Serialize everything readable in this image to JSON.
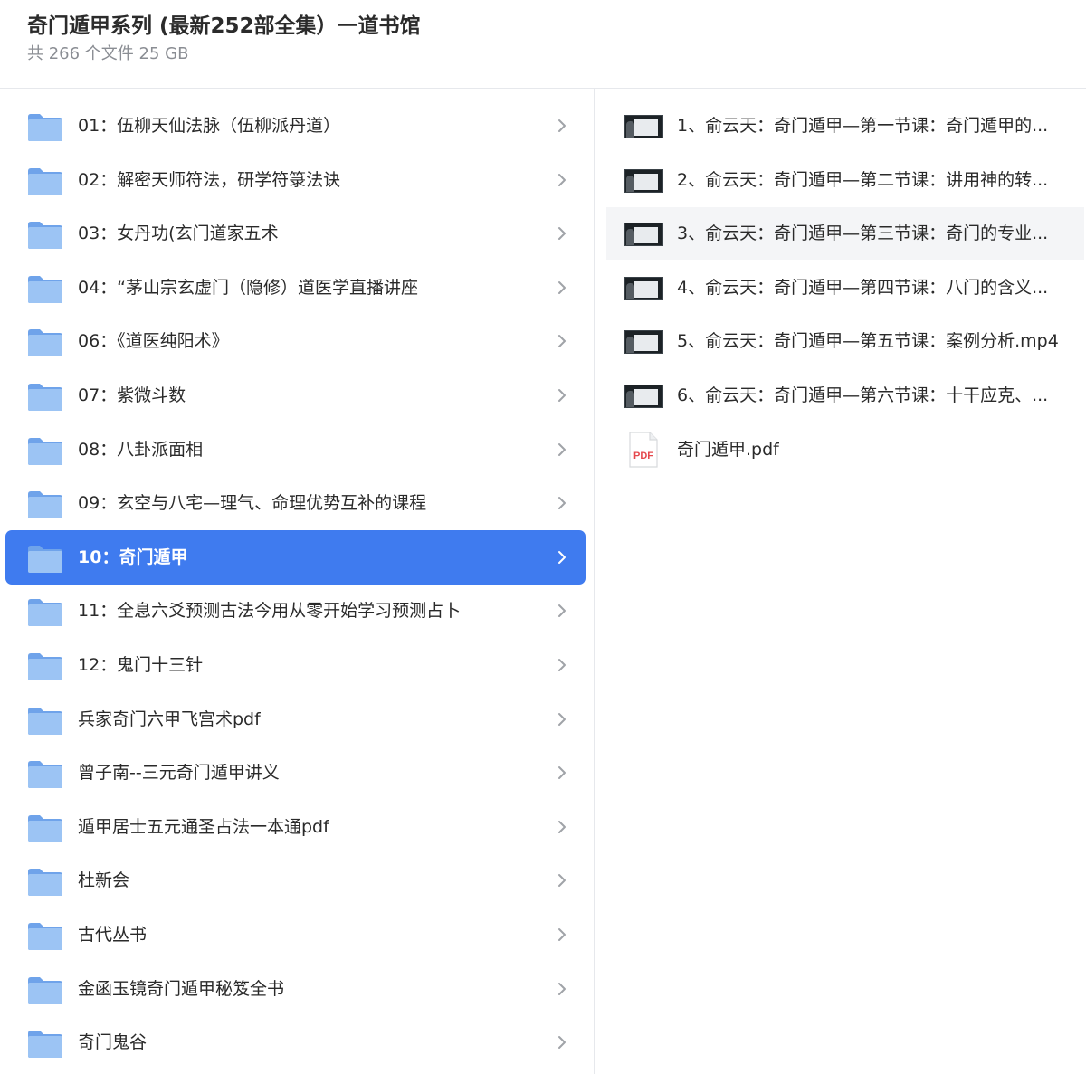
{
  "header": {
    "title": "奇门遁甲系列 (最新252部全集）一道书馆",
    "subtitle": "共 266 个文件 25 GB"
  },
  "folders": [
    {
      "label": "01：伍柳天仙法脉（伍柳派丹道）"
    },
    {
      "label": "02：解密天师符法，研学符箓法诀"
    },
    {
      "label": "03：女丹功(玄门道家五术"
    },
    {
      "label": "04：“茅山宗玄虚门（隐修）道医学直播讲座"
    },
    {
      "label": "06：《道医纯阳术》"
    },
    {
      "label": "07：紫微斗数"
    },
    {
      "label": "08：八卦派面相"
    },
    {
      "label": "09：玄空与八宅—理气、命理优势互补的课程"
    },
    {
      "label": "10：奇门遁甲",
      "selected": true
    },
    {
      "label": "11：全息六爻预测古法今用从零开始学习预测占卜"
    },
    {
      "label": "12：鬼门十三针"
    },
    {
      "label": "兵家奇门六甲飞宫术pdf"
    },
    {
      "label": "曾子南--三元奇门遁甲讲义"
    },
    {
      "label": "遁甲居士五元通圣占法一本通pdf"
    },
    {
      "label": "杜新会"
    },
    {
      "label": "古代丛书"
    },
    {
      "label": "金函玉镜奇门遁甲秘笈全书"
    },
    {
      "label": "奇门鬼谷"
    }
  ],
  "files": [
    {
      "label": "1、俞云天：奇门遁甲—第一节课：奇门遁甲的...",
      "type": "video-thumbnail"
    },
    {
      "label": "2、俞云天：奇门遁甲—第二节课：讲用神的转...",
      "type": "video-thumbnail"
    },
    {
      "label": "3、俞云天：奇门遁甲—第三节课：奇门的专业...",
      "type": "video-thumbnail",
      "hover": true
    },
    {
      "label": "4、俞云天：奇门遁甲—第四节课：八门的含义...",
      "type": "video-thumbnail"
    },
    {
      "label": "5、俞云天：奇门遁甲—第五节课：案例分析.mp4",
      "type": "video-thumbnail"
    },
    {
      "label": "6、俞云天：奇门遁甲—第六节课：十干应克、...",
      "type": "video-thumbnail"
    },
    {
      "label": "奇门遁甲.pdf",
      "type": "pdf-icon",
      "icon_text": "PDF"
    }
  ],
  "colors": {
    "accent": "#3f7bef",
    "folder": "#8cb8f0",
    "pdf": "#e5484d"
  }
}
